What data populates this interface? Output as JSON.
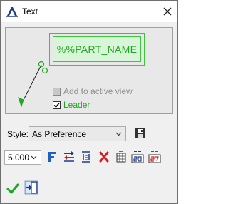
{
  "window": {
    "title": "Text",
    "icons": {
      "title": "text-tool-icon",
      "close": "close-icon"
    }
  },
  "preview": {
    "sample_text": "%%PART_NAME",
    "add_to_active_view_label": "Add to active view",
    "add_to_active_view_checked": false,
    "add_to_active_view_enabled": false,
    "leader_label": "Leader",
    "leader_checked": true,
    "colors": {
      "text": "#1ea81e",
      "frame": "#3dc53d",
      "leader": "#1ea81e"
    }
  },
  "style": {
    "label": "Style:",
    "selected": "As Preference",
    "save_icon": "save-icon"
  },
  "size": {
    "selected": "5.000"
  },
  "toolbar": {
    "icons": [
      "font-icon",
      "text-direction-icon",
      "text-fit-icon",
      "delete-icon",
      "symbol-table-icon",
      "special-text-icon",
      "special-text-alt-icon"
    ]
  },
  "footer": {
    "icons": [
      "ok-check-icon",
      "apply-exit-icon"
    ]
  }
}
